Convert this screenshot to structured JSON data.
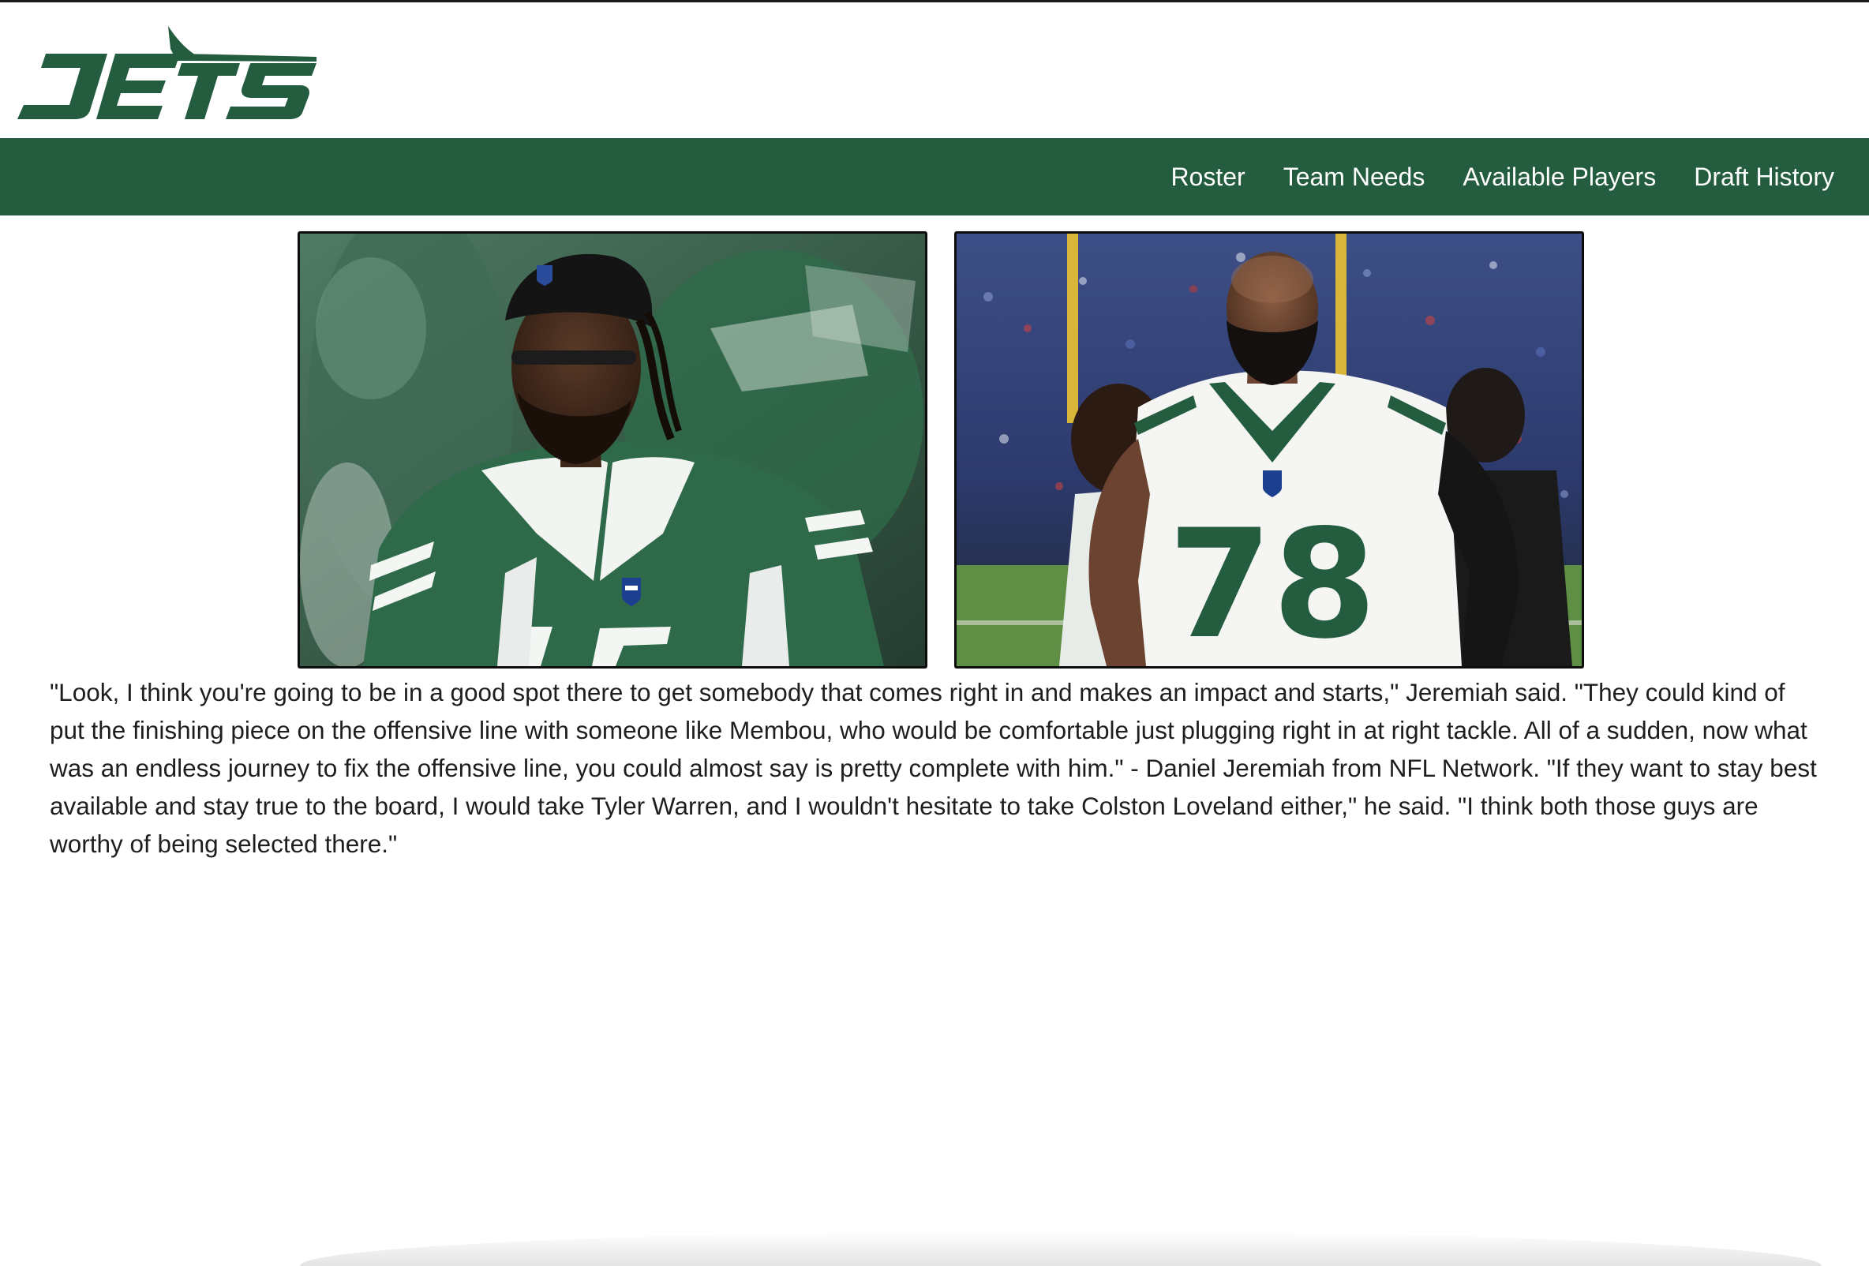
{
  "brand": {
    "logo_text": "JETS",
    "primary_color": "#235c3e",
    "background_color": "#ffffff"
  },
  "nav": {
    "items": [
      {
        "label": "Roster"
      },
      {
        "label": "Team Needs"
      },
      {
        "label": "Available Players"
      },
      {
        "label": "Draft History"
      }
    ]
  },
  "photos": [
    {
      "subject": "player-green-jersey-17"
    },
    {
      "subject": "player-white-jersey-78",
      "jersey_number": "78"
    }
  ],
  "article": {
    "quote": "\"Look, I think you're going to be in a good spot there to get somebody that comes right in and makes an impact and starts,\" Jeremiah said. \"They could kind of put the finishing piece on the offensive line with someone like Membou, who would be comfortable just plugging right in at right tackle. All of a sudden, now what was an endless journey to fix the offensive line, you could almost say is pretty complete with him.\" - Daniel Jeremiah from NFL Network. \"If they want to stay best available and stay true to the board, I would take Tyler Warren, and I wouldn't hesitate to take Colston Loveland either,\" he said. \"I think both those guys are worthy of being selected there.\""
  }
}
